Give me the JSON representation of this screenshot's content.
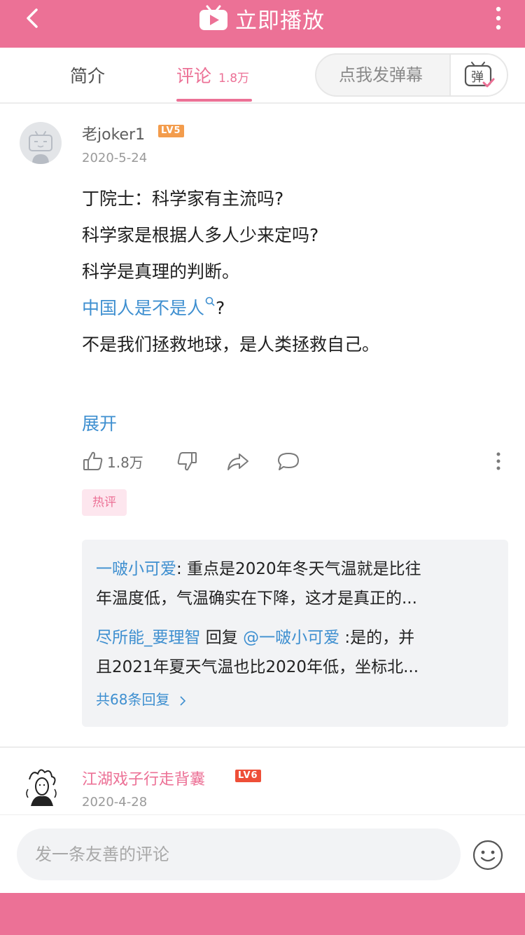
{
  "header": {
    "back_icon": "chevron-left-icon",
    "play_label": "立即播放",
    "more_icon": "more-vertical-icon",
    "background": "#ec7196"
  },
  "tabs": {
    "intro": "简介",
    "comments": "评论",
    "comments_count": "1.8万",
    "danmaku_placeholder": "点我发弹幕",
    "danmaku_icon_text": "弹"
  },
  "comments": [
    {
      "username": "老joker1",
      "level": "LV5",
      "level_color": "#f39c4c",
      "date": "2020-5-24",
      "lines": [
        "丁院士：科学家有主流吗?",
        "科学家是根据人多人少来定吗?",
        "科学是真理的判断。",
        "不是我们拯救地球，是人类拯救自己。"
      ],
      "link_text": "中国人是不是人",
      "link_suffix": "?",
      "expand": "展开",
      "likes": "1.8万",
      "hot_badge": "热评",
      "replies": [
        {
          "author": "一啵小可爱",
          "text_line1": ": 重点是2020年冬天气温就是比往",
          "text_line2": "年温度低，气温确实在下降，这才是真正的..."
        },
        {
          "author": "尽所能_要理智",
          "reply_word": " 回复 ",
          "mention": "@一啵小可爱",
          "text_line1": " :是的，并",
          "text_line2": "且2021年夏天气温也比2020年低，坐标北..."
        }
      ],
      "reply_count": "共68条回复"
    },
    {
      "username": "江湖戏子行走背囊",
      "level": "LV6",
      "level_color": "#ee4f38",
      "date": "2020-4-28"
    }
  ],
  "composer": {
    "placeholder": "发一条友善的评论",
    "emoji_icon": "smiley-icon"
  }
}
